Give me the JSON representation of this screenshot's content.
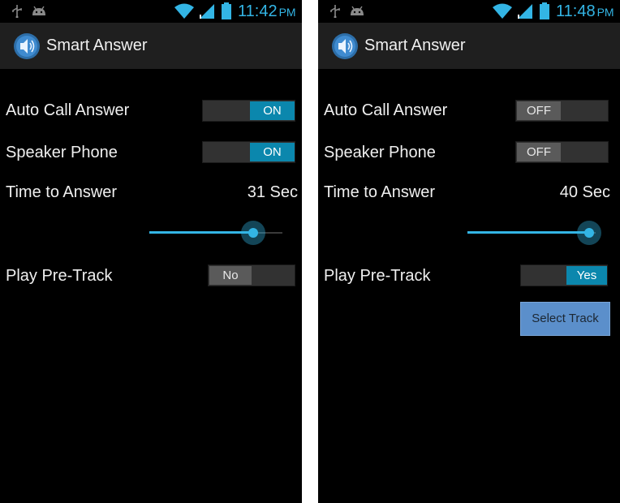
{
  "screens": [
    {
      "status_bar": {
        "time": "11:42",
        "ampm": "PM"
      },
      "app_title": "Smart Answer",
      "auto_call_answer": {
        "label": "Auto Call Answer",
        "state": "ON"
      },
      "speaker_phone": {
        "label": "Speaker Phone",
        "state": "ON"
      },
      "time_to_answer": {
        "label": "Time to Answer",
        "value": "31 Sec",
        "slider_fraction": 0.78
      },
      "play_pre_track": {
        "label": "Play Pre-Track",
        "state": "No"
      }
    },
    {
      "status_bar": {
        "time": "11:48",
        "ampm": "PM"
      },
      "app_title": "Smart Answer",
      "auto_call_answer": {
        "label": "Auto Call Answer",
        "state": "OFF"
      },
      "speaker_phone": {
        "label": "Speaker Phone",
        "state": "OFF"
      },
      "time_to_answer": {
        "label": "Time to Answer",
        "value": "40 Sec",
        "slider_fraction": 1.0
      },
      "play_pre_track": {
        "label": "Play Pre-Track",
        "state": "Yes"
      },
      "select_track_label": "Select Track"
    }
  ],
  "colors": {
    "accent": "#33b5e5",
    "toggle_on": "#0b87ad",
    "toggle_off": "#5a5a5a",
    "actionbar": "#1f1f1f",
    "select_button": "#5b8fcb"
  },
  "icons": [
    "usb-icon",
    "android-icon",
    "wifi-icon",
    "signal-icon",
    "battery-icon",
    "speaker-app-icon"
  ]
}
